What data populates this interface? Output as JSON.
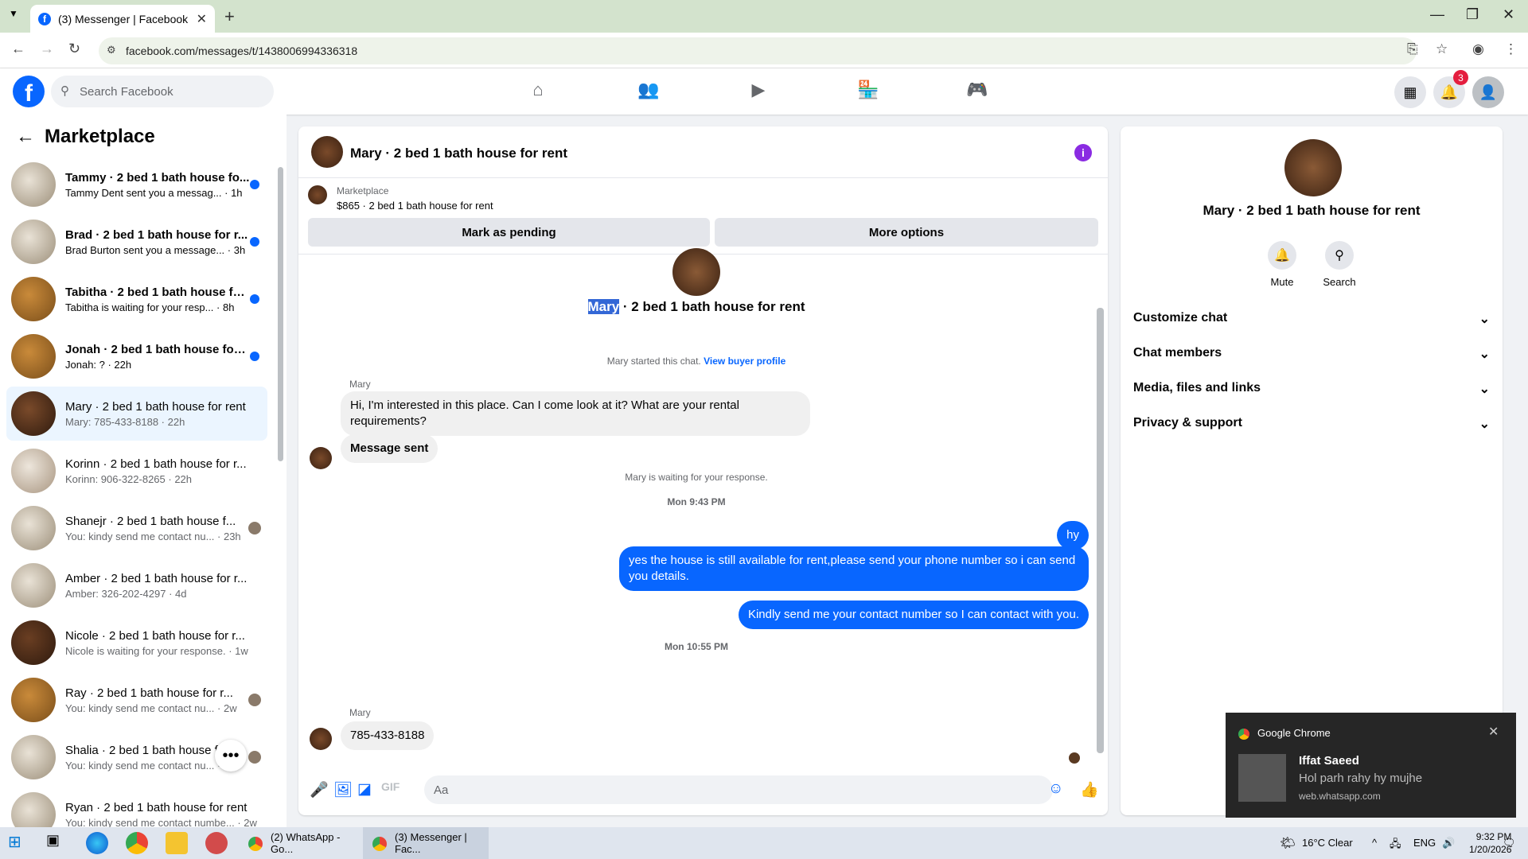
{
  "browser": {
    "tab_title": "(3) Messenger | Facebook",
    "url": "facebook.com/messages/t/1438006994336318",
    "new_tab": "+",
    "tab_close": "✕"
  },
  "fb": {
    "logo": "f",
    "search_placeholder": "Search Facebook",
    "notif_count": "3"
  },
  "sidebar": {
    "title": "Marketplace",
    "conversations": [
      {
        "name": "Tammy · 2 bed 1 bath house fo...",
        "sub": "Tammy Dent sent you a messag... · 1h",
        "unread": true
      },
      {
        "name": "Brad · 2 bed 1 bath house for r...",
        "sub": "Brad Burton sent you a message... · 3h",
        "unread": true
      },
      {
        "name": "Tabitha · 2 bed 1 bath house fo...",
        "sub": "Tabitha is waiting for your resp... · 8h",
        "unread": true
      },
      {
        "name": "Jonah · 2 bed 1 bath house for ...",
        "sub": "Jonah: ? · 22h",
        "unread": true
      },
      {
        "name": "Mary · 2 bed 1 bath house for rent",
        "sub": "Mary: 785-433-8188 · 22h",
        "unread": false
      },
      {
        "name": "Korinn · 2 bed 1 bath house for r...",
        "sub": "Korinn: 906-322-8265 · 22h",
        "unread": false
      },
      {
        "name": "Shanejr · 2 bed 1 bath house f...",
        "sub": "You: kindy send me contact nu... · 23h",
        "unread": false
      },
      {
        "name": "Amber · 2 bed 1 bath house for r...",
        "sub": "Amber: 326-202-4297 · 4d",
        "unread": false
      },
      {
        "name": "Nicole · 2 bed 1 bath house for r...",
        "sub": "Nicole is waiting for your response. · 1w",
        "unread": false
      },
      {
        "name": "Ray · 2 bed 1 bath house for r...",
        "sub": "You: kindy send me contact nu... · 2w",
        "unread": false
      },
      {
        "name": "Shalia · 2 bed 1 bath house fo...",
        "sub": "You: kindy send me contact nu... · 2w",
        "unread": false
      },
      {
        "name": "Ryan · 2 bed 1 bath house for rent",
        "sub": "You: kindy send me contact numbe... · 2w",
        "unread": false
      }
    ]
  },
  "chat": {
    "title": "Mary · 2 bed 1 bath house for rent",
    "listing_label": "Marketplace",
    "listing_price": "$865 · 2 bed 1 bath house for rent",
    "btn_pending": "Mark as pending",
    "btn_more": "More options",
    "intro_name_hl": "Mary",
    "intro_name_rest": " · 2 bed 1 bath house for rent",
    "started": "Mary started this chat. ",
    "view_profile": "View buyer profile",
    "sender1": "Mary",
    "msg1": "Hi, I'm interested in this place.  Can I come look at it?   What are your rental requirements?",
    "msg2": "Message sent",
    "waiting": "Mary is waiting for your response.",
    "ts1": "Mon 9:43 PM",
    "out1": "hy",
    "out2": "yes the house is still available for rent,please send your phone number so i can send you details.",
    "out3": "Kindly send me your contact number so I can contact with you.",
    "ts2": "Mon 10:55 PM",
    "sender2": "Mary",
    "msg3": "785-433-8188",
    "input_placeholder": "Aa"
  },
  "panel": {
    "title": "Mary · 2 bed 1 bath house for rent",
    "mute": "Mute",
    "search": "Search",
    "sections": [
      "Customize chat",
      "Chat members",
      "Media, files and links",
      "Privacy & support"
    ]
  },
  "toast": {
    "app": "Google Chrome",
    "sender": "Iffat Saeed",
    "message": "Hol parh rahy hy mujhe",
    "source": "web.whatsapp.com"
  },
  "taskbar": {
    "win1": "(2) WhatsApp - Go...",
    "win2": "(3) Messenger | Fac...",
    "weather": "16°C  Clear",
    "lang": "ENG",
    "time": "9:32 PM",
    "date": "1/20/2026"
  },
  "colors": {
    "accent": "#0866ff",
    "selected_row": "#ebf5ff",
    "info": "#8a2be2"
  }
}
